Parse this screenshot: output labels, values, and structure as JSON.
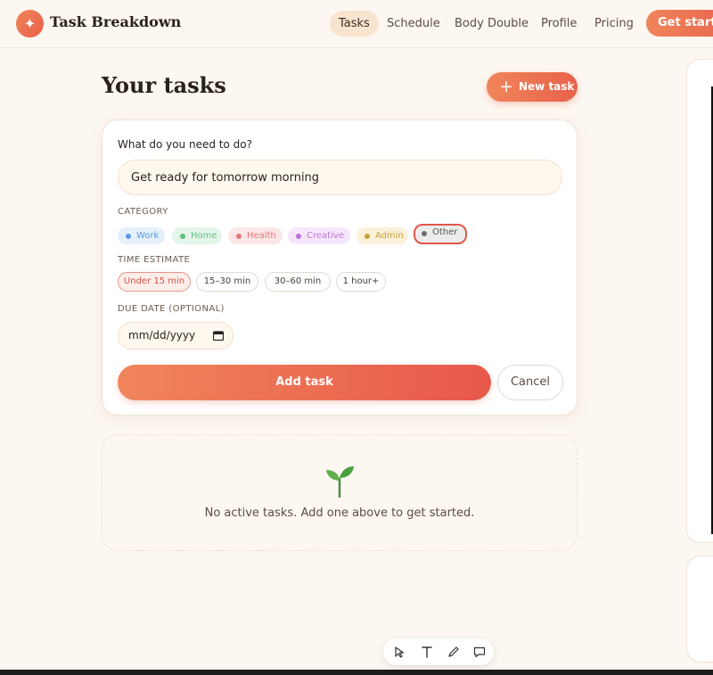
{
  "app": {
    "name": "Task Breakdown",
    "logo_icon": "sparkle-icon",
    "accent": "#e8634c"
  },
  "nav": {
    "links": [
      "Tasks",
      "Schedule",
      "Body Double",
      "Profile",
      "Pricing"
    ],
    "active": "Tasks",
    "cta": "Get started"
  },
  "page": {
    "title": "Your tasks",
    "new_task_label": "New task"
  },
  "form": {
    "question": "What do you need to do?",
    "task_value": "Get ready for tomorrow morning",
    "category_label": "CATEGORY",
    "categories": [
      {
        "label": "Work",
        "color": "#5b9be6",
        "bg": "#e6f0fb"
      },
      {
        "label": "Home",
        "color": "#5fbf7c",
        "bg": "#e4f5ea"
      },
      {
        "label": "Health",
        "color": "#e27a7a",
        "bg": "#fbe7e7"
      },
      {
        "label": "Creative",
        "color": "#c074db",
        "bg": "#f6e6fb"
      },
      {
        "label": "Admin",
        "color": "#c9a23c",
        "bg": "#fbf1da"
      },
      {
        "label": "Other",
        "color": "#6d6d6d",
        "bg": "#ececec"
      }
    ],
    "selected_category": "Other",
    "time_label": "TIME ESTIMATE",
    "time_options": [
      "Under 15 min",
      "15–30 min",
      "30–60 min",
      "1 hour+"
    ],
    "selected_time": "Under 15 min",
    "due_label": "DUE DATE (OPTIONAL)",
    "due_placeholder": "mm/dd/yyyy",
    "add_label": "Add task",
    "cancel_label": "Cancel"
  },
  "empty": {
    "icon": "seedling-icon",
    "message": "No active tasks. Add one above to get started."
  }
}
